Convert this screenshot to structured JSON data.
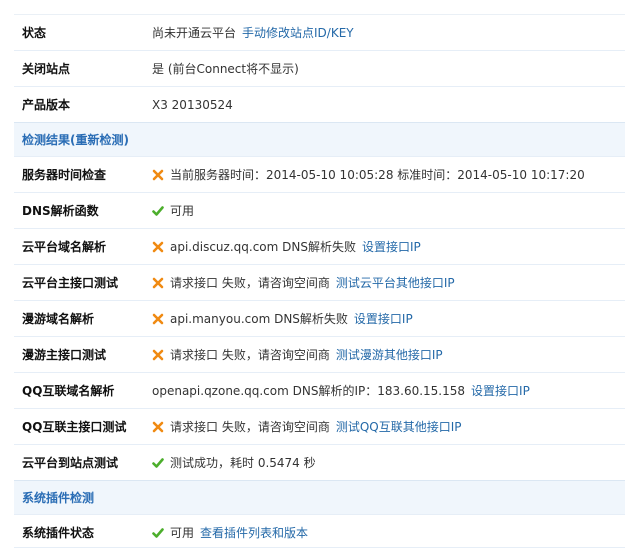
{
  "rows_top": [
    {
      "label": "状态",
      "value": "尚未开通云平台",
      "link": "手动修改站点ID/KEY"
    },
    {
      "label": "关闭站点",
      "value": "是 (前台Connect将不显示)"
    },
    {
      "label": "产品版本",
      "value": "X3 20130524"
    }
  ],
  "section1": {
    "title": "检测结果(重新检测)"
  },
  "checks": [
    {
      "label": "服务器时间检查",
      "status": "fail",
      "value": "当前服务器时间：2014-05-10 10:05:28 标准时间：2014-05-10 10:17:20"
    },
    {
      "label": "DNS解析函数",
      "status": "ok",
      "value": "可用"
    },
    {
      "label": "云平台域名解析",
      "status": "fail",
      "value": "api.discuz.qq.com DNS解析失败",
      "link": "设置接口IP"
    },
    {
      "label": "云平台主接口测试",
      "status": "fail",
      "value": "请求接口 失败，请咨询空间商",
      "link": "测试云平台其他接口IP"
    },
    {
      "label": "漫游域名解析",
      "status": "fail",
      "value": "api.manyou.com DNS解析失败",
      "link": "设置接口IP"
    },
    {
      "label": "漫游主接口测试",
      "status": "fail",
      "value": "请求接口 失败，请咨询空间商",
      "link": "测试漫游其他接口IP"
    },
    {
      "label": "QQ互联域名解析",
      "status": "none",
      "value": "openapi.qzone.qq.com DNS解析的IP：183.60.15.158",
      "link": "设置接口IP"
    },
    {
      "label": "QQ互联主接口测试",
      "status": "fail",
      "value": "请求接口 失败，请咨询空间商",
      "link": "测试QQ互联其他接口IP"
    },
    {
      "label": "云平台到站点测试",
      "status": "ok",
      "value": "测试成功，耗时 0.5474 秒"
    }
  ],
  "section2": {
    "title": "系统插件检测"
  },
  "plugin_row": {
    "label": "系统插件状态",
    "status": "ok",
    "value": "可用",
    "link": "查看插件列表和版本"
  },
  "colors": {
    "fail": "#f08a12",
    "ok": "#4cae2c",
    "link": "#2469a8",
    "section_bg": "#f0f6fc"
  }
}
